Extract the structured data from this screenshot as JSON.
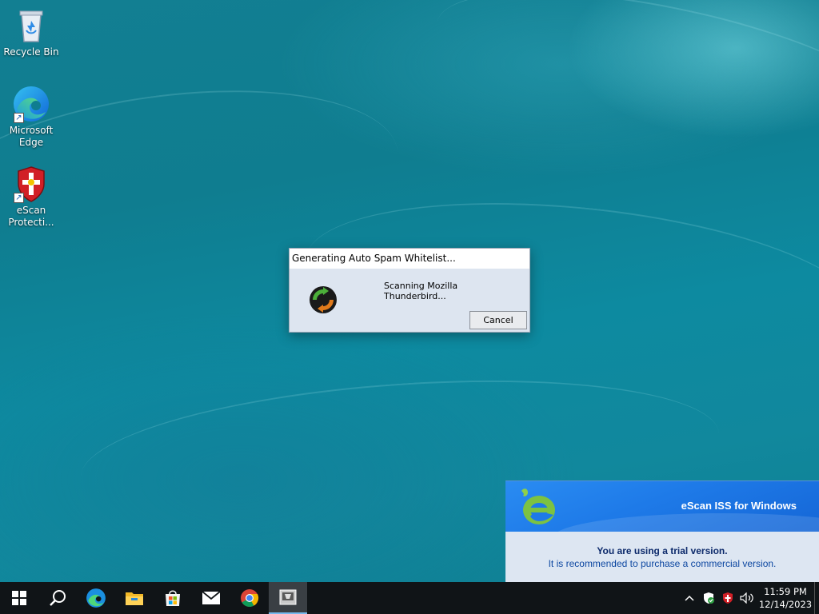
{
  "desktop": {
    "icons": [
      {
        "label": "Recycle Bin"
      },
      {
        "label": "Microsoft Edge"
      },
      {
        "label": "eScan Protecti..."
      }
    ]
  },
  "dialog": {
    "title": "Generating Auto Spam Whitelist...",
    "message": "Scanning Mozilla Thunderbird...",
    "cancel_label": "Cancel"
  },
  "escan_popup": {
    "product": "eScan ISS for Windows",
    "trial_message": "You are using a trial version.",
    "recommend_message": "It is recommended to purchase a commercial version."
  },
  "taskbar": {
    "apps": [
      "start-icon",
      "search-icon",
      "edge-icon",
      "file-explorer-icon",
      "store-icon",
      "mail-icon",
      "chrome-icon",
      "escan-app-icon"
    ],
    "clock_time": "11:59 PM",
    "clock_date": "12/14/2023"
  },
  "colors": {
    "taskbar_bg": "#101417",
    "dialog_bg": "#dde5f0",
    "escan_banner": "#1e7ae8",
    "escan_text": "#0d47a1"
  }
}
